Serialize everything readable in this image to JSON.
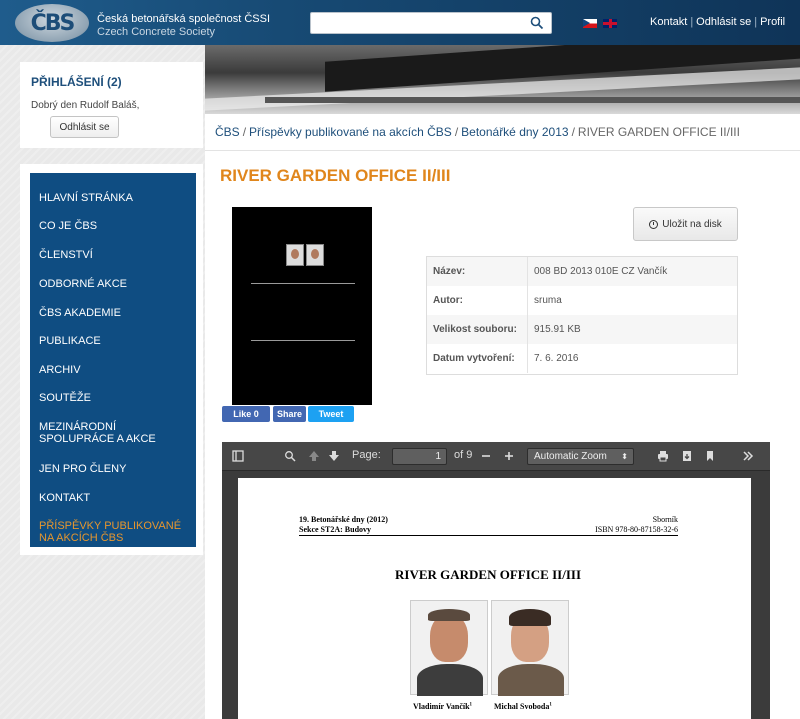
{
  "header": {
    "org_cs": "Česká betonářská společnost ČSSI",
    "org_en": "Czech Concrete Society",
    "logo_text": "ČBS",
    "search": {
      "placeholder": ""
    },
    "links": {
      "contact": "Kontakt",
      "logout": "Odhlásit se",
      "profile": "Profil",
      "sep": "|"
    }
  },
  "login": {
    "title": "PŘIHLÁŠENÍ (2)",
    "greeting": "Dobrý den Rudolf Baláš,",
    "logout_button": "Odhlásit se"
  },
  "nav": {
    "items": [
      "HLAVNÍ STRÁNKA",
      "CO JE ČBS",
      "ČLENSTVÍ",
      "ODBORNÉ AKCE",
      "ČBS AKADEMIE",
      "PUBLIKACE",
      "ARCHIV",
      "SOUTĚŽE",
      "MEZINÁRODNÍ",
      "SPOLUPRÁCE A AKCE",
      "JEN PRO ČLENY",
      "KONTAKT",
      "PŘÍSPĚVKY PUBLIKOVANÉ",
      "NA AKCÍCH ČBS"
    ]
  },
  "breadcrumb": {
    "items": [
      "ČBS",
      "Příspěvky publikované na akcích ČBS",
      "Betonářké dny 2013",
      "RIVER GARDEN OFFICE II/III"
    ],
    "sep": "/"
  },
  "page": {
    "title": "RIVER GARDEN OFFICE II/III",
    "save_button": "Uložit na disk",
    "social": {
      "like": "Like 0",
      "share": "Share",
      "tweet": "Tweet"
    }
  },
  "meta": {
    "rows": [
      {
        "key": "Název:",
        "value": "008 BD 2013 010E CZ Vančík"
      },
      {
        "key": "Autor:",
        "value": "sruma"
      },
      {
        "key": "Velikost souboru:",
        "value": "915.91 KB"
      },
      {
        "key": "Datum vytvoření:",
        "value": "7. 6. 2016"
      }
    ]
  },
  "pdf": {
    "page_label": "Page:",
    "page_value": "1",
    "page_total": "of 9",
    "zoom": "Automatic Zoom",
    "doc": {
      "line1_left": "19. Betonářské dny (2012)",
      "line2_left": "Sekce ST2A: Budovy",
      "line1_right": "Sborník",
      "line2_right": "ISBN 978-80-87158-32-6",
      "title": "RIVER GARDEN OFFICE II/III",
      "author1": "Vladimír Vančík",
      "author2": "Michal Svoboda",
      "sup": "1"
    }
  },
  "colors": {
    "header_blue": "#174a74",
    "nav_blue": "#0f4d82",
    "accent_orange": "#e0861c",
    "link_blue": "#1e4f7b"
  }
}
